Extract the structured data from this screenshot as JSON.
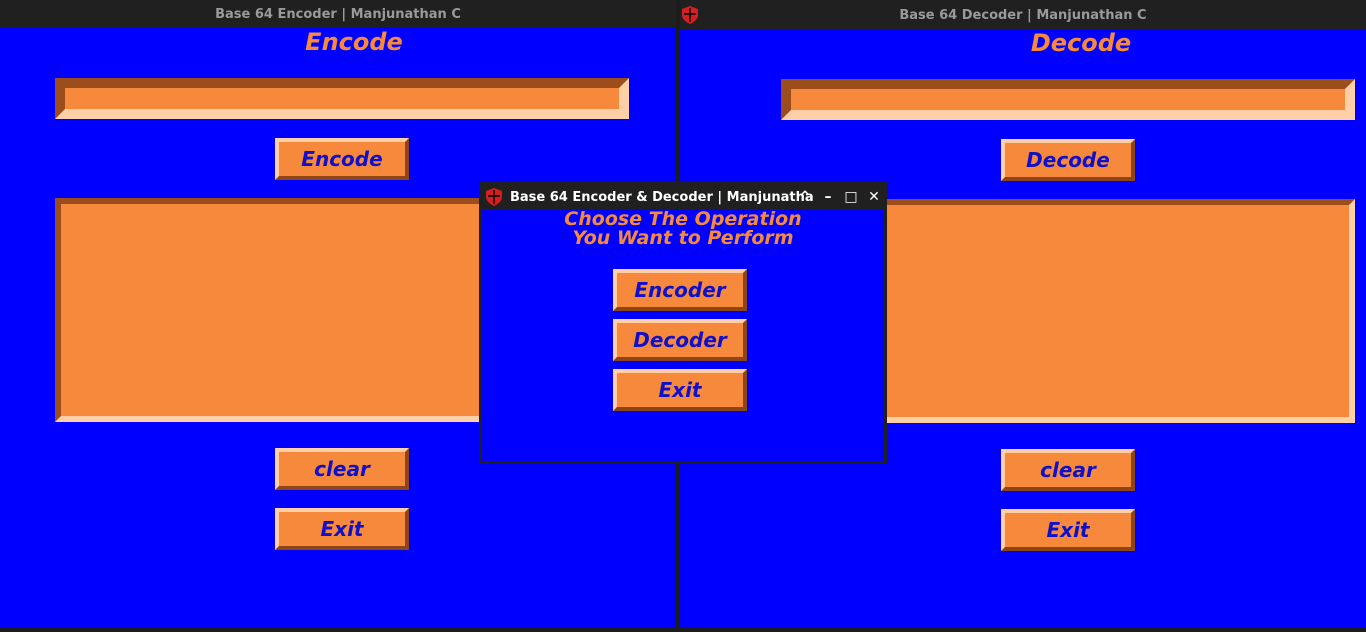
{
  "encoder_window": {
    "title": "Base 64 Encoder | Manjunathan C",
    "heading": "Encode",
    "input_value": "",
    "output_value": "",
    "encode_button": "Encode",
    "clear_button": "clear",
    "exit_button": "Exit"
  },
  "decoder_window": {
    "title": "Base 64 Decoder | Manjunathan C",
    "heading": "Decode",
    "input_value": "",
    "output_value": "",
    "decode_button": "Decode",
    "clear_button": "clear",
    "exit_button": "Exit"
  },
  "menu_dialog": {
    "title": "Base 64 Encoder & Decoder | Manjunatha",
    "heading_line1": "Choose The Operation",
    "heading_line2": "You Want to Perform",
    "encoder_button": "Encoder",
    "decoder_button": "Decoder",
    "exit_button": "Exit",
    "controls": {
      "shade": "⌃",
      "minimize": "–",
      "maximize": "□",
      "close": "✕"
    }
  },
  "colors": {
    "background": "#0000ff",
    "accent": "#f6893b",
    "button_text": "#1010c8",
    "titlebar": "#202020",
    "app_icon": "#d42020"
  },
  "icons": {
    "app": "shield-icon"
  }
}
